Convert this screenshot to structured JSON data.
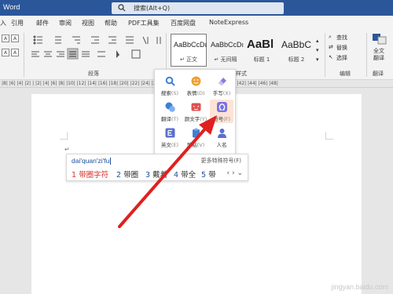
{
  "window": {
    "title": "Word"
  },
  "search": {
    "text": "搜索(Alt+Q)"
  },
  "menu": {
    "items": [
      {
        "label": "入"
      },
      {
        "label": "引用"
      },
      {
        "label": "邮件"
      },
      {
        "label": "审阅"
      },
      {
        "label": "视图"
      },
      {
        "label": "帮助"
      },
      {
        "label": "PDF工具集"
      },
      {
        "label": "百度网盘"
      },
      {
        "label": "NoteExpress"
      }
    ]
  },
  "ribbon": {
    "paragraph_group": "段落",
    "styles_group": "样式",
    "editing_group": "编辑",
    "translate_group": "翻译",
    "styles": [
      {
        "sample": "AaBbCcDı",
        "name": "↵ 正文"
      },
      {
        "sample": "AaBbCcDı",
        "name": "↵ 无间隔"
      },
      {
        "sample": "AaBl",
        "name": "标题 1"
      },
      {
        "sample": "AaBbC",
        "name": "标题 2"
      }
    ],
    "editing": {
      "find": "查找",
      "replace": "替换",
      "select": "选择"
    },
    "translate": {
      "full_text": "全文",
      "translate": "翻译"
    }
  },
  "ruler": {
    "numbers": "|8| |6| |4| |2| |  |2| |4| |6| |8| |10| |12| |14| |16| |18| |20| |22| |24| |26| |28| |30| |32| |34| |36| |38| |40| |42| |44| |46| |48|"
  },
  "symbol_popup": {
    "items": [
      {
        "label": "搜索",
        "key": "(S)",
        "icon": "magnifier-icon",
        "color": "#3f7fd6"
      },
      {
        "label": "表情",
        "key": "(D)",
        "icon": "smiley-icon",
        "color": "#f0a030"
      },
      {
        "label": "手写",
        "key": "(X)",
        "icon": "eraser-icon",
        "color": "#8a7ae0"
      },
      {
        "label": "翻译",
        "key": "(T)",
        "icon": "translate-icon",
        "color": "#3f7fd6"
      },
      {
        "label": "颜文字",
        "key": "(Y)",
        "icon": "kaomoji-icon",
        "color": "#e05050"
      },
      {
        "label": "符号",
        "key": "(F)",
        "icon": "omega-icon",
        "color": "#7a72e0"
      },
      {
        "label": "英文",
        "key": "(E)",
        "icon": "english-icon",
        "color": "#5a6fd0"
      },
      {
        "label": "剪贴",
        "key": "(V)",
        "icon": "clipboard-icon",
        "color": "#3f7fd6"
      },
      {
        "label": "人名",
        "key": "",
        "icon": "person-icon",
        "color": "#5a6fd0"
      }
    ]
  },
  "ime": {
    "pinyin": "dai'quan'zi'fu",
    "more_symbols": "更多特殊符号(F)",
    "candidates": [
      {
        "num": "1",
        "text": "带圈字符"
      },
      {
        "num": "2",
        "text": "带圈"
      },
      {
        "num": "3",
        "text": "戴着"
      },
      {
        "num": "4",
        "text": "带全"
      },
      {
        "num": "5",
        "text": "带"
      }
    ],
    "nav": "‹ › ⌄"
  },
  "watermark": "jingyan.baidu.com",
  "colors": {
    "titlebar": "#2b579a",
    "accent_red": "#d9302a",
    "active_item": "#fde3d6"
  }
}
